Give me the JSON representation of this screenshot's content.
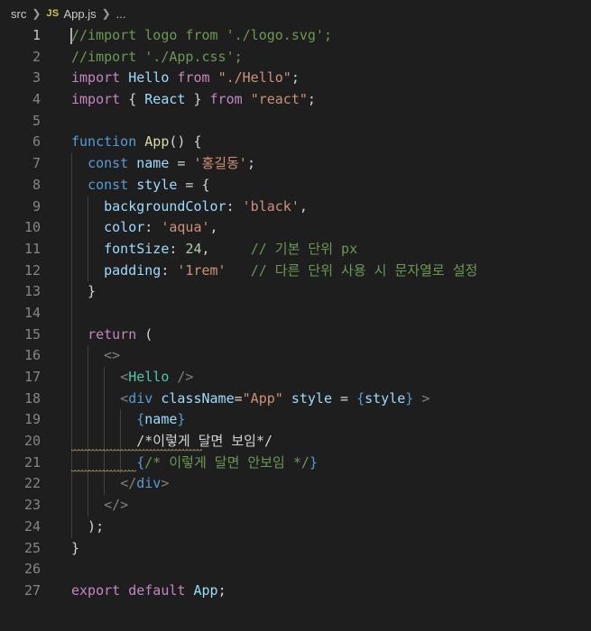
{
  "breadcrumb": {
    "folder": "src",
    "file_icon": "JS",
    "file": "App.js",
    "more": "...",
    "separator_icon": "chevron-right-icon"
  },
  "editor": {
    "active_line": 1,
    "squiggle_lines": [
      20,
      21
    ],
    "lines": [
      {
        "n": "1",
        "tokens": [
          [
            "cm",
            "//import logo from './logo.svg';"
          ]
        ]
      },
      {
        "n": "2",
        "tokens": [
          [
            "cm",
            "//import './App.css';"
          ]
        ]
      },
      {
        "n": "3",
        "tokens": [
          [
            "kw",
            "import"
          ],
          [
            "p",
            " "
          ],
          [
            "var",
            "Hello"
          ],
          [
            "p",
            " "
          ],
          [
            "kw",
            "from"
          ],
          [
            "p",
            " "
          ],
          [
            "str",
            "\"./Hello\""
          ],
          [
            "p",
            ";"
          ]
        ]
      },
      {
        "n": "4",
        "tokens": [
          [
            "kw",
            "import"
          ],
          [
            "p",
            " { "
          ],
          [
            "var",
            "React"
          ],
          [
            "p",
            " } "
          ],
          [
            "kw",
            "from"
          ],
          [
            "p",
            " "
          ],
          [
            "str",
            "\"react\""
          ],
          [
            "p",
            ";"
          ]
        ]
      },
      {
        "n": "5",
        "tokens": []
      },
      {
        "n": "6",
        "tokens": [
          [
            "st",
            "function"
          ],
          [
            "p",
            " "
          ],
          [
            "fn",
            "App"
          ],
          [
            "p",
            "() {"
          ]
        ]
      },
      {
        "n": "7",
        "tokens": [
          [
            "p",
            "  "
          ],
          [
            "st",
            "const"
          ],
          [
            "p",
            " "
          ],
          [
            "var",
            "name"
          ],
          [
            "p",
            " = "
          ],
          [
            "str",
            "'홍길동'"
          ],
          [
            "p",
            ";"
          ]
        ]
      },
      {
        "n": "8",
        "tokens": [
          [
            "p",
            "  "
          ],
          [
            "st",
            "const"
          ],
          [
            "p",
            " "
          ],
          [
            "var",
            "style"
          ],
          [
            "p",
            " = {"
          ]
        ]
      },
      {
        "n": "9",
        "tokens": [
          [
            "p",
            "    "
          ],
          [
            "var",
            "backgroundColor"
          ],
          [
            "p",
            ": "
          ],
          [
            "str",
            "'black'"
          ],
          [
            "p",
            ","
          ]
        ]
      },
      {
        "n": "10",
        "tokens": [
          [
            "p",
            "    "
          ],
          [
            "var",
            "color"
          ],
          [
            "p",
            ": "
          ],
          [
            "str",
            "'aqua'"
          ],
          [
            "p",
            ","
          ]
        ]
      },
      {
        "n": "11",
        "tokens": [
          [
            "p",
            "    "
          ],
          [
            "var",
            "fontSize"
          ],
          [
            "p",
            ": "
          ],
          [
            "num",
            "24"
          ],
          [
            "p",
            ",     "
          ],
          [
            "cm",
            "// 기본 단위 px"
          ]
        ]
      },
      {
        "n": "12",
        "tokens": [
          [
            "p",
            "    "
          ],
          [
            "var",
            "padding"
          ],
          [
            "p",
            ": "
          ],
          [
            "str",
            "'1rem'"
          ],
          [
            "p",
            "   "
          ],
          [
            "cm",
            "// 다른 단위 사용 시 문자열로 설정"
          ]
        ]
      },
      {
        "n": "13",
        "tokens": [
          [
            "p",
            "  }"
          ]
        ]
      },
      {
        "n": "14",
        "tokens": []
      },
      {
        "n": "15",
        "tokens": [
          [
            "p",
            "  "
          ],
          [
            "kw",
            "return"
          ],
          [
            "p",
            " ("
          ]
        ]
      },
      {
        "n": "16",
        "tokens": [
          [
            "p",
            "    "
          ],
          [
            "pun",
            "<>"
          ]
        ]
      },
      {
        "n": "17",
        "tokens": [
          [
            "p",
            "      "
          ],
          [
            "pun",
            "<"
          ],
          [
            "tag",
            "Hello"
          ],
          [
            "p",
            " "
          ],
          [
            "pun",
            "/>"
          ]
        ]
      },
      {
        "n": "18",
        "tokens": [
          [
            "p",
            "      "
          ],
          [
            "pun",
            "<"
          ],
          [
            "br",
            "div"
          ],
          [
            "p",
            " "
          ],
          [
            "attr",
            "className"
          ],
          [
            "p",
            "="
          ],
          [
            "str",
            "\"App\""
          ],
          [
            "p",
            " "
          ],
          [
            "attr",
            "style"
          ],
          [
            "p",
            " = "
          ],
          [
            "br",
            "{"
          ],
          [
            "var",
            "style"
          ],
          [
            "br",
            "}"
          ],
          [
            "p",
            " "
          ],
          [
            "pun",
            ">"
          ]
        ]
      },
      {
        "n": "19",
        "tokens": [
          [
            "p",
            "        "
          ],
          [
            "br",
            "{"
          ],
          [
            "var",
            "name"
          ],
          [
            "br",
            "}"
          ]
        ]
      },
      {
        "n": "20",
        "tokens": [
          [
            "p",
            "        /*이렇게 달면 보임*/"
          ]
        ]
      },
      {
        "n": "21",
        "tokens": [
          [
            "p",
            "        "
          ],
          [
            "br",
            "{"
          ],
          [
            "cm",
            "/* 이렇게 달면 안보임 */"
          ],
          [
            "br",
            "}"
          ]
        ]
      },
      {
        "n": "22",
        "tokens": [
          [
            "p",
            "      "
          ],
          [
            "pun",
            "</"
          ],
          [
            "br",
            "div"
          ],
          [
            "pun",
            ">"
          ]
        ]
      },
      {
        "n": "23",
        "tokens": [
          [
            "p",
            "    "
          ],
          [
            "pun",
            "</>"
          ]
        ]
      },
      {
        "n": "24",
        "tokens": [
          [
            "p",
            "  );"
          ]
        ]
      },
      {
        "n": "25",
        "tokens": [
          [
            "p",
            "}"
          ]
        ]
      },
      {
        "n": "26",
        "tokens": []
      },
      {
        "n": "27",
        "tokens": [
          [
            "kw",
            "export"
          ],
          [
            "p",
            " "
          ],
          [
            "kw",
            "default"
          ],
          [
            "p",
            " "
          ],
          [
            "var",
            "App"
          ],
          [
            "p",
            ";"
          ]
        ]
      }
    ]
  }
}
